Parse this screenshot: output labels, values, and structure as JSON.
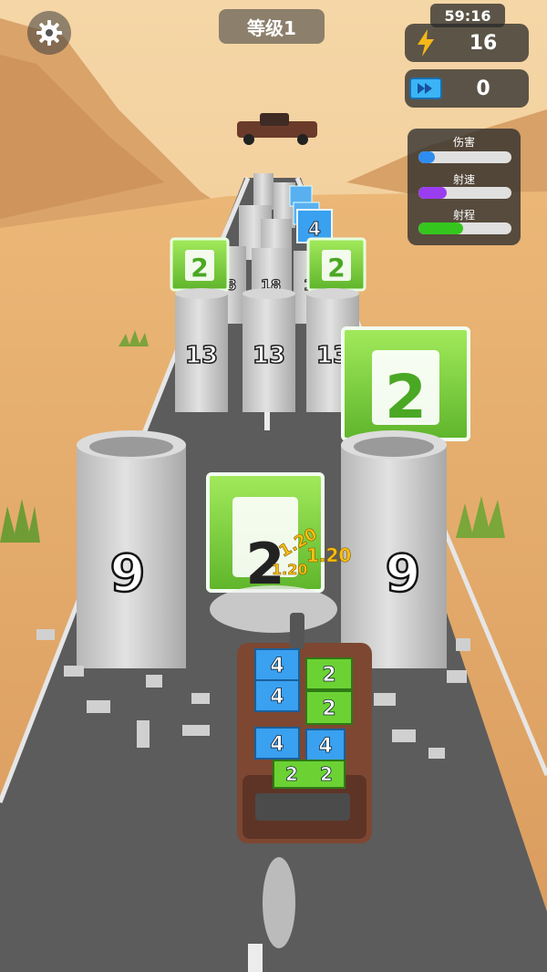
{
  "hud": {
    "level_label": "等级1",
    "timer": "59:16",
    "energy": "16",
    "speed_tickets": "0"
  },
  "stats": [
    {
      "label": "伤害",
      "fill": 0.18,
      "color": "#2f8cf0"
    },
    {
      "label": "射速",
      "fill": 0.3,
      "color": "#9a3df0"
    },
    {
      "label": "射程",
      "fill": 0.48,
      "color": "#35c61e"
    }
  ],
  "pillars": {
    "front_left": "9",
    "front_right": "9",
    "mid_left": "13",
    "mid_center": "13",
    "mid_right": "13",
    "far_1": "18",
    "far_2": "18",
    "far_3": "18"
  },
  "crates": {
    "center_front": "2",
    "right_front": "2",
    "left_far": "2",
    "right_far": "2",
    "blue_far": "4"
  },
  "damage_popups": [
    "1.20",
    "1.20",
    "1.20"
  ],
  "truck_cargo": [
    "4",
    "4",
    "4",
    "4",
    "2",
    "2",
    "2",
    "2"
  ],
  "colors": {
    "sky": "#f2c98e",
    "sand": "#e7b173",
    "road": "#5e5e5e",
    "pillar": "#cfcfcf",
    "crate_green": "#7ed43b",
    "crate_blue": "#3aa0f0",
    "energy": "#f5b818",
    "ticket": "#3ab4f5"
  }
}
